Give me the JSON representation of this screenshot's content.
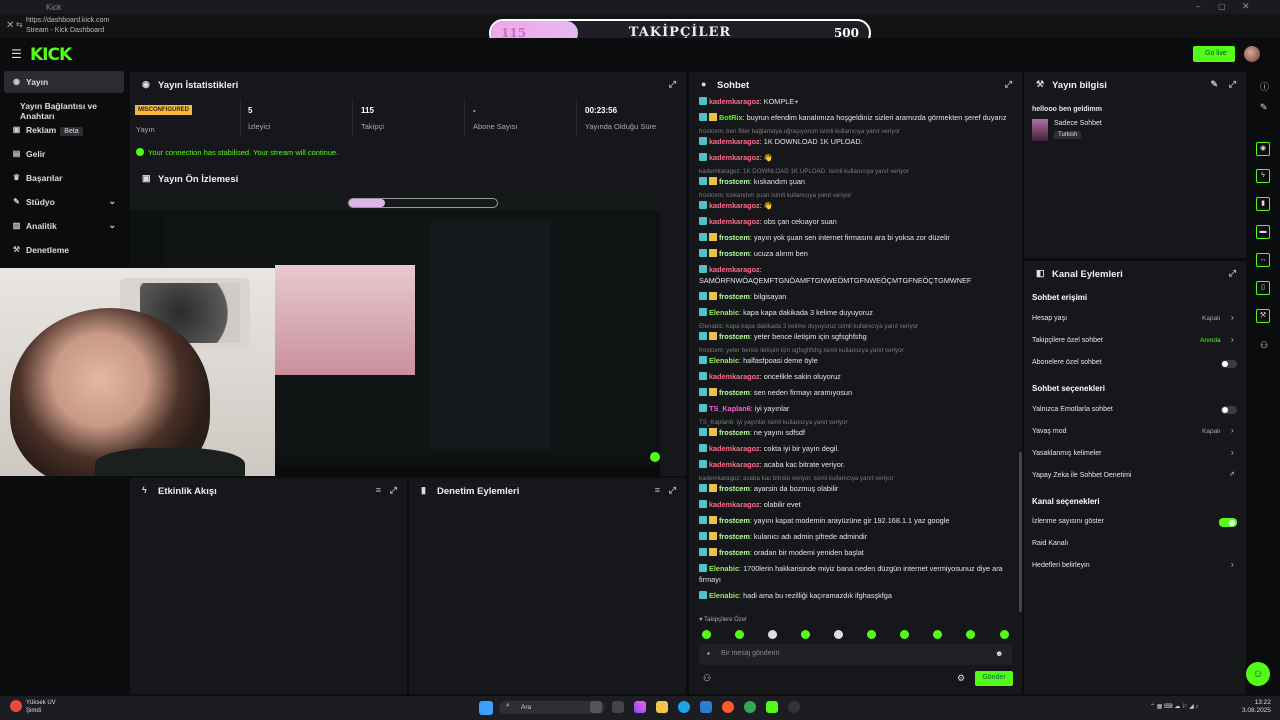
{
  "browser": {
    "tab_title": "Kick",
    "url": "https://dashboard.kick.com",
    "subtitle": "Stream - Kick Dashboard"
  },
  "follower_goal": {
    "label": "TAKİPÇİLER",
    "current": "115",
    "target": "500",
    "progress": 0.23
  },
  "header": {
    "logo": "KICK",
    "go_live": "Go live"
  },
  "sidebar": {
    "items": [
      {
        "label": "Yayın",
        "icon": "broadcast-icon"
      },
      {
        "label": "Yayın Bağlantısı ve Anahtarı",
        "icon": ""
      },
      {
        "label": "Reklam",
        "badge": "Beta",
        "icon": "ad-icon"
      },
      {
        "label": "Gelir",
        "icon": "revenue-icon"
      },
      {
        "label": "Başarılar",
        "icon": "trophy-icon"
      },
      {
        "label": "Stüdyo",
        "icon": "studio-icon"
      },
      {
        "label": "Analitik",
        "icon": "analytics-icon"
      },
      {
        "label": "Denetleme",
        "icon": "moderation-icon"
      }
    ]
  },
  "stats": {
    "title": "Yayın İstatistikleri",
    "status_badge": "MISCONFIGURED",
    "status_label": "Yayın",
    "viewers_value": "5",
    "viewers_label": "İzleyici",
    "followers_value": "115",
    "followers_label": "Takipçi",
    "subs_value": "-",
    "subs_label": "Abone Sayısı",
    "uptime_value": "00:23:56",
    "uptime_label": "Yayında Olduğu Süre",
    "connection_message": "Your connection has stabilised. Your stream will continue."
  },
  "preview": {
    "title": "Yayın Ön İzlemesi"
  },
  "activity": {
    "title": "Etkinlik Akışı"
  },
  "modlog": {
    "title": "Denetim Eylemleri"
  },
  "chat": {
    "title": "Sohbet",
    "messages": [
      {
        "user": "kademkaragoz",
        "text": "KOMPLE+",
        "cls": "u-k"
      },
      {
        "user": "BotRix",
        "text": "buyrun efendim kanalımıza hoşgeldiniz sizleri aramızda görmekten şeref duyarız",
        "cls": "u-b"
      },
      {
        "reply": "frostcem: ben filter bağlamaya uğraşıyorum isimli kullanıcıya yanıt veriyor"
      },
      {
        "user": "kademkaragoz",
        "text": "1K DOWNLOAD 1K UPLOAD.",
        "cls": "u-k"
      },
      {
        "user": "kademkaragoz",
        "text": "👋",
        "cls": "u-k"
      },
      {
        "reply": "kademkaragoz: 1K DOWNLOAD 1K UPLOAD. isimli kullanıcıya yanıt veriyor"
      },
      {
        "user": "frostcem",
        "text": "kıskandım şuan",
        "cls": "u-f"
      },
      {
        "reply": "frostcem: kıskandım şuan isimli kullanıcıya yanıt veriyor"
      },
      {
        "user": "kademkaragoz",
        "text": "👋",
        "cls": "u-k"
      },
      {
        "user": "kademkaragoz",
        "text": "obs çan cekıayor suan",
        "cls": "u-k"
      },
      {
        "user": "frostcem",
        "text": "yayın yok şuan sen internet firmasını ara bi yoksa zor düzelir",
        "cls": "u-f"
      },
      {
        "user": "frostcem",
        "text": "ucuza alırım ben",
        "cls": "u-f"
      },
      {
        "user": "kademkaragoz",
        "text": "SAMÖRFNWÖAQEMFTGNÖAMFTGNWEÖMTGFNWEÖÇMTGFNEÖÇTGMWNEF",
        "cls": "u-k",
        "wrap": true
      },
      {
        "user": "frostcem",
        "text": "bilgisayan",
        "cls": "u-f"
      },
      {
        "user": "Elenabic",
        "text": "kapa kapa dakikada 3 kelime duyuyoruz",
        "cls": "u-e"
      },
      {
        "reply": "Elenabic: kapa kapa dakikada 3 kelime duyuyoruz isimli kullanıcıya yanıt veriyor"
      },
      {
        "user": "frostcem",
        "text": "yeter bence iletişim için sgfsghfshg",
        "cls": "u-f"
      },
      {
        "reply": "frostcem: yeter bence iletişim için sgfsghfshg isimli kullanıcıya yanıt veriyor"
      },
      {
        "user": "Elenabic",
        "text": "halfasfpoasi deme öyle",
        "cls": "u-e"
      },
      {
        "user": "kademkaragoz",
        "text": "oncelikle sakin oluyoruz",
        "cls": "u-k"
      },
      {
        "user": "frostcem",
        "text": "sen neden firmayı aramıyosun",
        "cls": "u-f"
      },
      {
        "user": "TS_Kaplan6",
        "text": "iyi yayınlar",
        "cls": "u-t"
      },
      {
        "reply": "TS_Kaplan6: iyi yayınlar isimli kullanıcıya yanıt veriyor"
      },
      {
        "user": "frostcem",
        "text": "ne yayını sdfsdf",
        "cls": "u-f"
      },
      {
        "user": "kademkaragoz",
        "text": "cokta iyi bir yayın degil.",
        "cls": "u-k"
      },
      {
        "user": "kademkaragoz",
        "text": "acaba kac bitrate veriyor.",
        "cls": "u-k"
      },
      {
        "reply": "kademkaragoz: acaba kac bitrate veriyor. isimli kullanıcıya yanıt veriyor"
      },
      {
        "user": "frostcem",
        "text": "ayarsin da bozmuş olabilir",
        "cls": "u-f"
      },
      {
        "user": "kademkaragoz",
        "text": "olabilir evet",
        "cls": "u-k"
      },
      {
        "user": "frostcem",
        "text": "yayını kapat modemin arayüzüne gir 192.168.1.1 yaz google",
        "cls": "u-f"
      },
      {
        "user": "frostcem",
        "text": "kulanıcı adı admin şifrede admindir",
        "cls": "u-f"
      },
      {
        "user": "frostcem",
        "text": "oradan bir modemi yeniden başlat",
        "cls": "u-f"
      },
      {
        "user": "Elenabic",
        "text": "1700lerin hakkarisinde miyiz bana neden düzgün internet vermiyosunuz diye ara firmayı",
        "cls": "u-e",
        "wrap": true
      },
      {
        "user": "Elenabic",
        "text": "hadi ama bu rezilliği kaçıramazdık ifghasşkfga",
        "cls": "u-e"
      }
    ],
    "followers_only_label": "Takipçilere Özel",
    "input_placeholder": "Bir mesaj gönderin",
    "send_label": "Gönder"
  },
  "stream_info": {
    "title": "Yayın bilgisi",
    "stream_title": "hellooo ben geldimm",
    "category": "Sadece Sohbet",
    "tag": "Turkish"
  },
  "channel_actions": {
    "title": "Kanal Eylemleri",
    "chat_access_section": "Sohbet erişimi",
    "account_age_label": "Hesap yaşı",
    "account_age_value": "Kapalı",
    "followers_only_label": "Takipçilere özel sohbet",
    "followers_only_value": "Anında",
    "subs_only_label": "Abonelere özel sohbet",
    "chat_options_section": "Sohbet seçenekleri",
    "emote_only_label": "Yalnızca Emotlarla sohbet",
    "slow_mode_label": "Yavaş mod",
    "slow_mode_value": "Kapalı",
    "banned_words_label": "Yasaklanmış kelimeler",
    "ai_moderation_label": "Yapay Zeka ile Sohbet Denetimi",
    "channel_options_section": "Kanal seçenekleri",
    "show_viewers_label": "İzlenme sayısını göster",
    "raid_label": "Raid Kanalı",
    "targets_label": "Hedefleri belirleyin"
  },
  "taskbar": {
    "weather_title": "Yüksek UV",
    "weather_sub": "Şimdi",
    "search_placeholder": "Ara",
    "time": "13:22",
    "date": "3.08.2025"
  }
}
